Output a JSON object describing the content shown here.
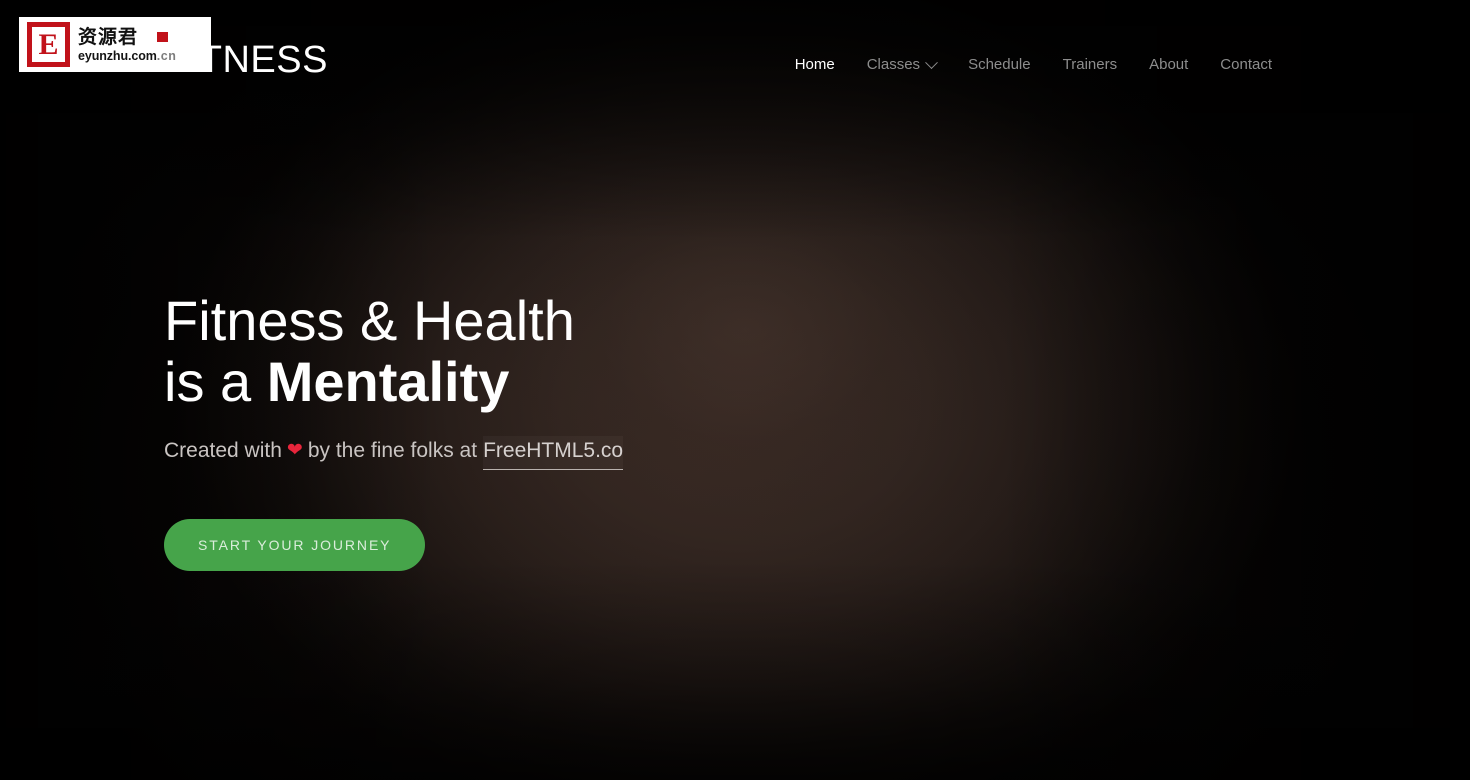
{
  "site": {
    "brand": "FITNESS"
  },
  "nav": {
    "items": [
      {
        "label": "Home",
        "active": true,
        "has_dropdown": false
      },
      {
        "label": "Classes",
        "active": false,
        "has_dropdown": true
      },
      {
        "label": "Schedule",
        "active": false,
        "has_dropdown": false
      },
      {
        "label": "Trainers",
        "active": false,
        "has_dropdown": false
      },
      {
        "label": "About",
        "active": false,
        "has_dropdown": false
      },
      {
        "label": "Contact",
        "active": false,
        "has_dropdown": false
      }
    ]
  },
  "hero": {
    "title_line1": "Fitness & Health",
    "title_line2_prefix": "is a ",
    "title_line2_strong": "Mentality",
    "subtitle_before": "Created with",
    "heart_glyph": "❤",
    "subtitle_middle": "by the fine folks at",
    "link_label": "FreeHTML5.co",
    "cta_label": "Start Your Journey"
  },
  "watermark": {
    "badge_letter": "E",
    "chinese": "资源君",
    "url": "eyunzhu.com",
    "url_faded": ".cn"
  },
  "colors": {
    "accent_green": "#46a44a",
    "heart_red": "#e8253b",
    "nav_inactive": "#8d8d8d",
    "nav_active": "#ffffff",
    "hero_text": "#ffffff",
    "background_center": "#332723",
    "background_edge": "#030202"
  }
}
